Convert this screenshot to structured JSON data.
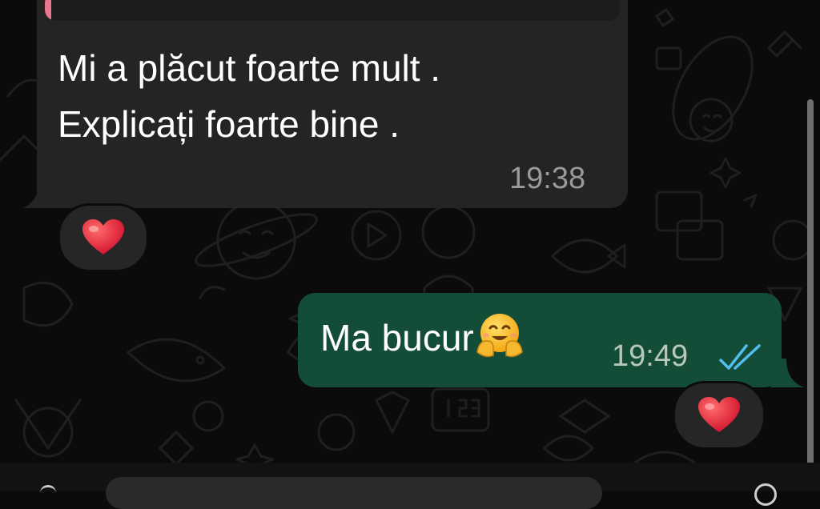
{
  "chat": {
    "incoming": {
      "text": "Mi a plăcut foarte mult .\nExplicați foarte bine .",
      "time": "19:38",
      "reaction": "❤️"
    },
    "outgoing": {
      "text": "Ma bucur",
      "emoji": "🤗",
      "time": "19:49",
      "status": "read",
      "reaction": "❤️"
    }
  },
  "colors": {
    "background": "#0b0b0b",
    "incoming_bubble": "#242424",
    "outgoing_bubble": "#144d37",
    "read_ticks": "#53bdeb",
    "quote_accent": "#e9768e"
  }
}
